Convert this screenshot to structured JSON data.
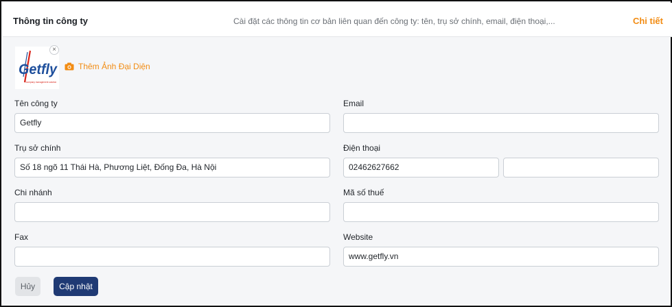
{
  "header": {
    "title": "Thông tin công ty",
    "description": "Cài đặt các thông tin cơ bản liên quan đến công ty: tên, trụ sở chính, email, điện thoại,...",
    "detail_link": "Chi tiết"
  },
  "logo": {
    "text": "Getfly",
    "tagline": "Fcompany management solution",
    "close_glyph": "×",
    "add_avatar_label": "Thêm Ảnh Đại Diện"
  },
  "form": {
    "company_name": {
      "label": "Tên công ty",
      "value": "Getfly"
    },
    "email": {
      "label": "Email",
      "value": ""
    },
    "headquarters": {
      "label": "Trụ sở chính",
      "value": "Số 18 ngõ 11 Thái Hà, Phương Liệt, Đống Đa, Hà Nội"
    },
    "phone": {
      "label": "Điện thoại",
      "value": "02462627662",
      "value2": ""
    },
    "branch": {
      "label": "Chi nhánh",
      "value": ""
    },
    "tax_code": {
      "label": "Mã số thuế",
      "value": ""
    },
    "fax": {
      "label": "Fax",
      "value": ""
    },
    "website": {
      "label": "Website",
      "value": "www.getfly.vn"
    }
  },
  "actions": {
    "cancel": "Hủy",
    "update": "Cập nhật"
  },
  "colors": {
    "accent": "#f28c13",
    "primary_button": "#1f3a74",
    "logo_blue": "#1e4f9c",
    "logo_red": "#d9261c"
  }
}
